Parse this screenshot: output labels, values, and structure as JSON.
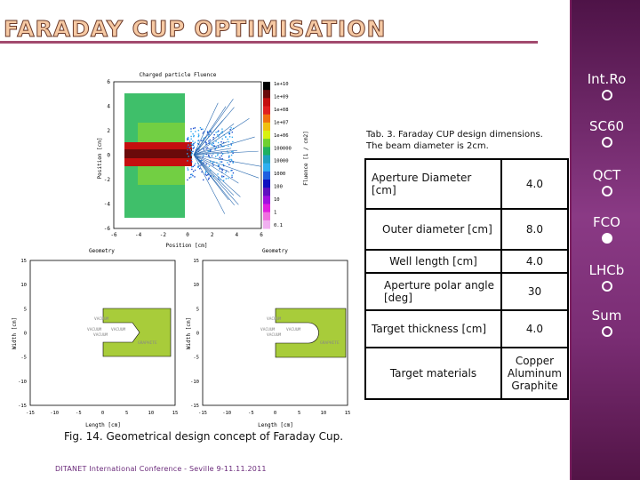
{
  "title": "FARADAY CUP OPTIMISATION",
  "sidebar": {
    "items": [
      {
        "label": "Int.Ro",
        "active": false
      },
      {
        "label": "SC60",
        "active": false
      },
      {
        "label": "QCT",
        "active": false
      },
      {
        "label": "FCO",
        "active": true
      },
      {
        "label": "LHCb",
        "active": false
      },
      {
        "label": "Sum",
        "active": false
      }
    ]
  },
  "fluence_plot": {
    "title": "Charged particle Fluence",
    "xlabel": "Position [cm]",
    "ylabel": "Position [cm]",
    "x_ticks": [
      "-6",
      "-4",
      "-2",
      "0",
      "2",
      "4",
      "6"
    ],
    "y_ticks": [
      "6",
      "4",
      "2",
      "0",
      "-2",
      "-4",
      "-6"
    ],
    "colorbar_label": "Fluence [1 / cm2]",
    "colorbar_ticks": [
      "1e+10",
      "1e+09",
      "1e+08",
      "1e+07",
      "1e+06",
      "100000",
      "10000",
      "1000",
      "100",
      "10",
      "1",
      "0.1"
    ],
    "footer_left": "Geometry",
    "footer_right": "Geometry"
  },
  "geometry_plots": [
    {
      "name": "conical",
      "xlabel": "Length [cm]",
      "ylabel": "Width [cm]",
      "x_ticks": [
        "-15",
        "-10",
        "-5",
        "0",
        "5",
        "10",
        "15"
      ],
      "y_ticks": [
        "15",
        "10",
        "5",
        "0",
        "-5",
        "-10",
        "-15"
      ],
      "labels": [
        "VACUUM",
        "VACUUM",
        "VACUUM",
        "VACUUM",
        "GRAPHITE"
      ]
    },
    {
      "name": "rounded",
      "xlabel": "Length [cm]",
      "ylabel": "Width [cm]",
      "x_ticks": [
        "-15",
        "-10",
        "-5",
        "0",
        "5",
        "10",
        "15"
      ],
      "y_ticks": [
        "15",
        "10",
        "5",
        "0",
        "-5",
        "-10",
        "-15"
      ],
      "labels": [
        "VACUUM",
        "VACUUM",
        "VACUUM",
        "VACUUM",
        "GRAPHITE"
      ]
    }
  ],
  "figure_caption": "Fig. 14. Geometrical design concept of Faraday Cup.",
  "table": {
    "caption_line1": "Tab. 3. Faraday CUP design dimensions.",
    "caption_line2": "The beam diameter is 2cm.",
    "rows": [
      {
        "param": "Aperture Diameter [cm]",
        "value": "4.0"
      },
      {
        "param": "Outer diameter [cm]",
        "value": "8.0"
      },
      {
        "param": "Well length [cm]",
        "value": "4.0"
      },
      {
        "param": "Aperture polar angle [deg]",
        "value": "30"
      },
      {
        "param": "Target thickness [cm]",
        "value": "4.0"
      },
      {
        "param": "Target materials",
        "value": "Copper Aluminum Graphite"
      }
    ]
  },
  "footer": "DITANET International Conference - Seville 9-11.11.2011",
  "colors": {
    "accent": "#a24a6e",
    "sidebar": "#7a2d74",
    "graphite": "#a8cc3a"
  }
}
